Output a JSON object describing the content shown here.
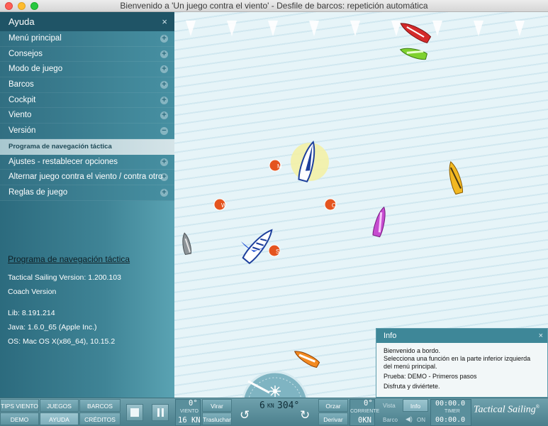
{
  "window": {
    "title": "Bienvenido a 'Un juego contra el viento' - Desfile de barcos: repetición automática"
  },
  "sidebar": {
    "header": "Ayuda",
    "close": "×",
    "items": [
      {
        "label": "Menú principal",
        "toggle": "+"
      },
      {
        "label": "Consejos",
        "toggle": "+"
      },
      {
        "label": "Modo de juego",
        "toggle": "+"
      },
      {
        "label": "Barcos",
        "toggle": "+"
      },
      {
        "label": "Cockpit",
        "toggle": "+"
      },
      {
        "label": "Viento",
        "toggle": "+"
      },
      {
        "label": "Versión",
        "toggle": "−"
      },
      {
        "label": "Programa de navegación táctica",
        "toggle": ""
      },
      {
        "label": "Ajustes - restablecer opciones",
        "toggle": "+"
      },
      {
        "label": "Alternar juego contra el viento / contra otro barco",
        "toggle": "+"
      },
      {
        "label": "Reglas de juego",
        "toggle": "+"
      }
    ],
    "info": {
      "title": "Programa de navegación táctica",
      "version": "Tactical Sailing Version: 1.200.103",
      "edition": "Coach Version",
      "lib": "Lib: 8.191.214",
      "java": "Java: 1.6.0_65 (Apple Inc.)",
      "os": "OS: Mac OS X(x86_64), 10.15.2"
    }
  },
  "sea": {
    "buoys": [
      {
        "label": "M"
      },
      {
        "label": "W"
      },
      {
        "label": "O"
      },
      {
        "label": "S"
      }
    ]
  },
  "infopanel": {
    "title": "Info",
    "close": "×",
    "line1": "Bienvenido a bordo.",
    "line2": "Selecciona una función en la parte inferior izquierda del menú principal.",
    "line3": "Prueba: DEMO - Primeros pasos",
    "line4": "Disfruta y diviértete."
  },
  "bottombar": {
    "tabs_top": [
      "TIPS VIENTO",
      "JUEGOS",
      "BARCOS"
    ],
    "tabs_bottom": [
      "DEMO",
      "AYUDA",
      "CRÉDITOS"
    ],
    "wind_angle": "0°",
    "wind_label": "VIENTO",
    "wind_speed": "16 KN",
    "virar": "Virar",
    "trasluchar": "Trasluchar",
    "compass_speed": "6",
    "compass_unit": "KN",
    "compass_heading": "304°",
    "orzar": "Orzar",
    "derivar": "Derivar",
    "current_angle": "0°",
    "current_label": "CORRIENTE",
    "current_speed": "0KN",
    "vista": "Vista",
    "info": "Info",
    "barco": "Barco",
    "sound": "ON",
    "time1": "00:00.0",
    "timer_label": "TIMER",
    "time2": "00:00.0",
    "logo": "Tactical Sailing",
    "logo_mark": "®"
  }
}
